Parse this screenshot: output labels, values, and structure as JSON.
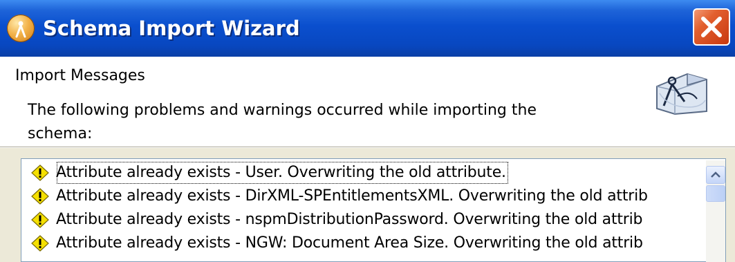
{
  "window": {
    "title": "Schema Import Wizard",
    "app_icon": "wizard-app-icon",
    "close_icon": "close-x-icon"
  },
  "header": {
    "title": "Import Messages",
    "description": "The following problems and warnings occurred while importing the schema:",
    "icon": "wizard-compass-icon"
  },
  "messages": [
    {
      "icon": "warning-icon",
      "text": "Attribute already exists - User.  Overwriting the old attribute."
    },
    {
      "icon": "warning-icon",
      "text": "Attribute already exists - DirXML-SPEntitlementsXML.  Overwriting the old attrib"
    },
    {
      "icon": "warning-icon",
      "text": "Attribute already exists - nspmDistributionPassword.  Overwriting the old attrib"
    },
    {
      "icon": "warning-icon",
      "text": "Attribute already exists - NGW: Document Area Size.  Overwriting the old attrib"
    }
  ],
  "colors": {
    "titlebar": "#0a4fce",
    "close_button": "#e25f2e",
    "panel": "#ece9d8",
    "warning": "#f5e000"
  }
}
